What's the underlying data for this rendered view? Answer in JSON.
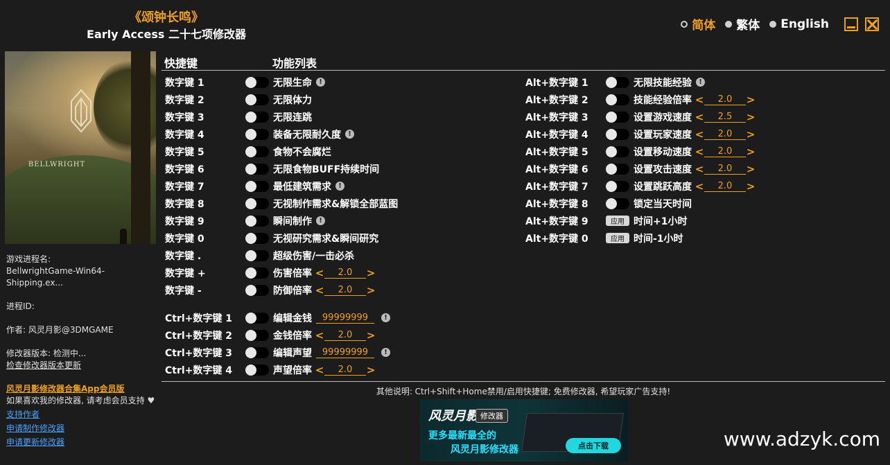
{
  "header": {
    "game_name": "《颂钟长鸣》",
    "trainer_name": "Early Access 二十七项修改器"
  },
  "languages": [
    {
      "label": "简体",
      "active": true
    },
    {
      "label": "繁体",
      "active": false
    },
    {
      "label": "English",
      "active": false
    }
  ],
  "cover": {
    "brand": "BELLWRIGHT"
  },
  "sidebar": {
    "process_name_label": "游戏进程名:",
    "process_name": "BellwrightGame-Win64-Shipping.ex...",
    "process_id_label": "进程ID:",
    "author": "作者: 风灵月影@3DMGAME",
    "version": "修改器版本: 检测中...",
    "check_update": "检查修改器版本更新",
    "promo": "风灵月影修改器合集App会员版",
    "support_text": "如果喜欢我的修改器, 请考虑会员支持",
    "heart": "♥",
    "links": [
      "支持作者",
      "申请制作修改器",
      "申请更新修改器"
    ]
  },
  "columns": {
    "hotkey": "快捷键",
    "features": "功能列表"
  },
  "left_rows": [
    {
      "key": "数字键 1",
      "label": "无限生命",
      "info": true
    },
    {
      "key": "数字键 2",
      "label": "无限体力"
    },
    {
      "key": "数字键 3",
      "label": "无限连跳"
    },
    {
      "key": "数字键 4",
      "label": "装备无限耐久度",
      "info": true
    },
    {
      "key": "数字键 5",
      "label": "食物不会腐烂"
    },
    {
      "key": "数字键 6",
      "label": "无限食物BUFF持续时间"
    },
    {
      "key": "数字键 7",
      "label": "最低建筑需求",
      "info": true
    },
    {
      "key": "数字键 8",
      "label": "无视制作需求&解锁全部蓝图"
    },
    {
      "key": "数字键 9",
      "label": "瞬间制作",
      "info": true
    },
    {
      "key": "数字键 0",
      "label": "无视研究需求&瞬间研究"
    },
    {
      "key": "数字键 .",
      "label": "超级伤害/一击必杀"
    },
    {
      "key": "数字键 +",
      "label": "伤害倍率",
      "value": "2.0"
    },
    {
      "key": "数字键 -",
      "label": "防御倍率",
      "value": "2.0"
    }
  ],
  "ctrl_rows": [
    {
      "key": "Ctrl+数字键 1",
      "label": "编辑金钱",
      "input": "99999999",
      "info": true
    },
    {
      "key": "Ctrl+数字键 2",
      "label": "金钱倍率",
      "value": "2.0"
    },
    {
      "key": "Ctrl+数字键 3",
      "label": "编辑声望",
      "input": "99999999",
      "info": true
    },
    {
      "key": "Ctrl+数字键 4",
      "label": "声望倍率",
      "value": "2.0"
    }
  ],
  "right_rows": [
    {
      "key": "Alt+数字键 1",
      "label": "无限技能经验",
      "info": true
    },
    {
      "key": "Alt+数字键 2",
      "label": "技能经验倍率",
      "value": "2.0"
    },
    {
      "key": "Alt+数字键 3",
      "label": "设置游戏速度",
      "value": "2.5"
    },
    {
      "key": "Alt+数字键 4",
      "label": "设置玩家速度",
      "value": "2.0"
    },
    {
      "key": "Alt+数字键 5",
      "label": "设置移动速度",
      "value": "2.0"
    },
    {
      "key": "Alt+数字键 6",
      "label": "设置攻击速度",
      "value": "2.0"
    },
    {
      "key": "Alt+数字键 7",
      "label": "设置跳跃高度",
      "value": "2.0"
    },
    {
      "key": "Alt+数字键 8",
      "label": "锁定当天时间"
    },
    {
      "key": "Alt+数字键 9",
      "label": "时间+1小时",
      "apply": "应用"
    },
    {
      "key": "Alt+数字键 0",
      "label": "时间-1小时",
      "apply": "应用"
    }
  ],
  "footer": {
    "note": "其他说明: Ctrl+Shift+Home禁用/启用快捷键; 免费修改器, 希望玩家广告支持!"
  },
  "banner": {
    "brand": "风灵月影",
    "tag": "修改器",
    "line1": "更多最新最全的",
    "line2": "风灵月影修改器",
    "download": "点击下载"
  },
  "watermark": "www.adzyk.com",
  "colors": {
    "accent": "#f0a020",
    "background": "#1c1c1c",
    "link": "#4aa0ff"
  }
}
